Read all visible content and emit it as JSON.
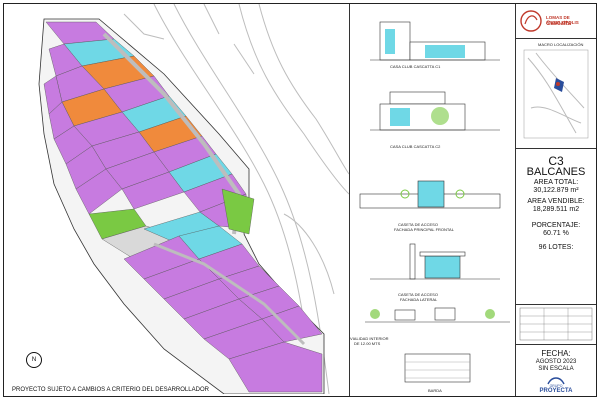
{
  "brand": {
    "line1": "LOMAS DE ANGELOPOLIS",
    "line2": "Cascatta"
  },
  "location": {
    "label": "MACRO LOCALIZACIÓN"
  },
  "section": {
    "code": "C3",
    "name": "BALCANES"
  },
  "area_total": {
    "label": "AREA TOTAL:",
    "value": "30,122.879 m²"
  },
  "area_vendible": {
    "label": "AREA VENDIBLE:",
    "value": "18,289.511 m2"
  },
  "porcentaje": {
    "label": "PORCENTAJE:",
    "value": "60.71 %"
  },
  "lotes": {
    "label": "96 LOTES:"
  },
  "fecha": {
    "label": "FECHA:",
    "value": "AGOSTO 2023",
    "scale": "SIN ESCALA"
  },
  "footer_brand": {
    "line1": "GRUPO",
    "line2": "PROYECTA"
  },
  "note": "PROYECTO SUJETO A CAMBIOS A CRITERIO DEL DESARROLLADOR",
  "north_symbol": "N",
  "elevations": {
    "caption1": "CASA CLUB CASCATTA C1",
    "caption2": "CASA CLUB CASCATTA C2",
    "caption3": "CASETA DE ACCESO",
    "caption3b": "FACHADA PRINCIPAL FRONTAL",
    "caption4": "CASETA DE ACCESO",
    "caption4b": "FACHADA LATERAL",
    "caption5": "VIALIDAD INTERIOR",
    "caption5b": "DE 12.00 MTS",
    "caption6": "BARDA"
  },
  "colors": {
    "lot_purple": "#c77be0",
    "lot_orange": "#f08a3c",
    "lot_cyan": "#6fd8e6",
    "green_area": "#7ac943",
    "road_gray": "#d9d9d9",
    "accent_red": "#c0392b",
    "brand_blue": "#2a4d9b"
  }
}
